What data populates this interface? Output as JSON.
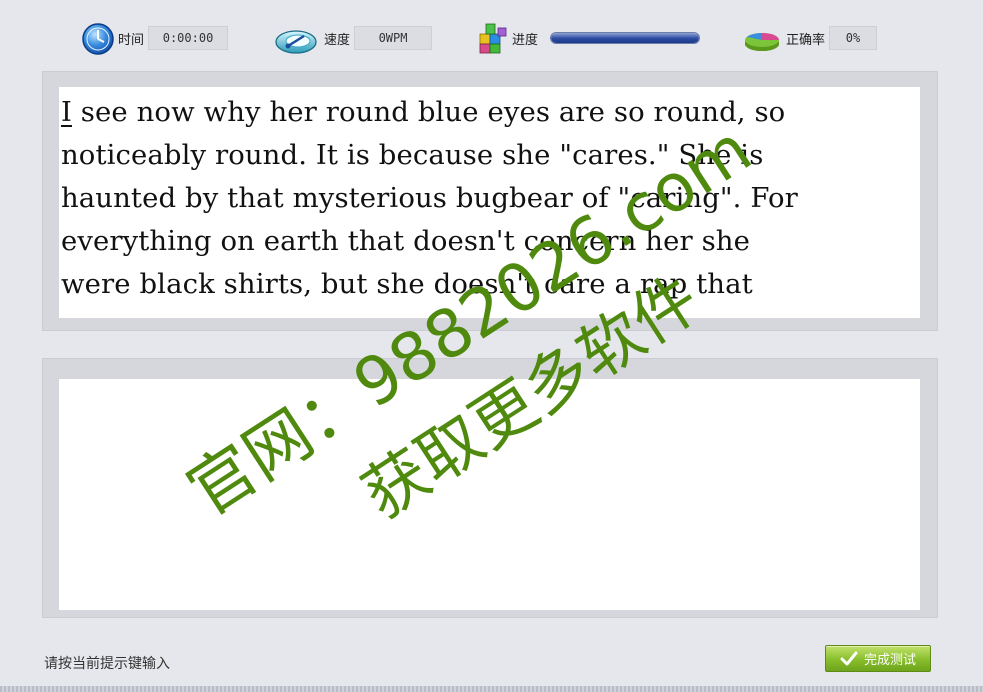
{
  "stats": {
    "time": {
      "icon": "clock-icon",
      "label": "时间",
      "value": "0:00:00"
    },
    "speed": {
      "icon": "speedometer-icon",
      "label": "速度",
      "value": "0WPM"
    },
    "progress": {
      "icon": "blocks-icon",
      "label": "进度",
      "fraction": 1.0
    },
    "accuracy": {
      "icon": "pie-chart-icon",
      "label": "正确率",
      "value": "0%"
    }
  },
  "source_text": {
    "cursor_char": "I",
    "lines": [
      " see now why her round blue eyes are so round, so",
      "noticeably round. It is because she \"cares.\" She is",
      "haunted by that mysterious bugbear of \"caring\". For",
      "everything on earth that doesn't concern her she",
      "were black shirts, but she doesn't care a rap that"
    ]
  },
  "typing_area": {
    "value": ""
  },
  "hint": "请按当前提示键输入",
  "finish_button": {
    "label": "完成测试",
    "icon": "check-icon"
  },
  "watermark": {
    "line1": "官网：9882026.com",
    "line2": "获取更多软件"
  },
  "colors": {
    "background": "#e6e7ec",
    "progress": "#2c4aa0",
    "button": "#88bd2c",
    "watermark": "#4f8a0f"
  }
}
